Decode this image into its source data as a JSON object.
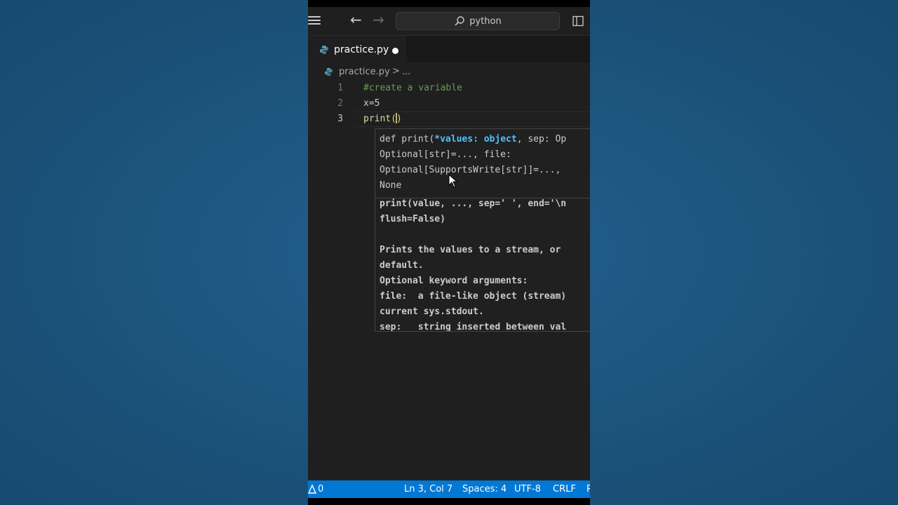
{
  "titlebar": {
    "search_text": "python"
  },
  "tab": {
    "label": "practice.py"
  },
  "breadcrumb": {
    "file": "practice.py",
    "separator": ">",
    "more": "..."
  },
  "editor": {
    "lines": [
      {
        "number": "1",
        "text": "#create a variable"
      },
      {
        "number": "2",
        "text": "x=5"
      },
      {
        "number": "3",
        "fn": "print",
        "open": "(",
        "close": ")"
      }
    ]
  },
  "hover": {
    "signature": {
      "prefix": "def print(",
      "param": "*values",
      "colon": ": ",
      "type": "object",
      "rest1": ", sep: Op",
      "line2": "Optional[str]=..., file:",
      "line3": "Optional[SupportsWrite[str]]=...,",
      "line4": "None"
    },
    "doc_lines": [
      "print(value, ..., sep=' ', end='\\n",
      "flush=False)",
      "",
      "Prints the values to a stream, or",
      "default.",
      "Optional keyword arguments:",
      "file:  a file-like object (stream)",
      "current sys.stdout.",
      "sep:   string inserted between val"
    ]
  },
  "statusbar": {
    "problems": "0",
    "position": "Ln 3, Col 7",
    "spaces": "Spaces: 4",
    "encoding": "UTF-8",
    "eol": "CRLF",
    "more": "P"
  },
  "colors": {
    "status_bg": "#0078d4",
    "editor_bg": "#1f1f1f",
    "page_bg": "#1d5580"
  }
}
